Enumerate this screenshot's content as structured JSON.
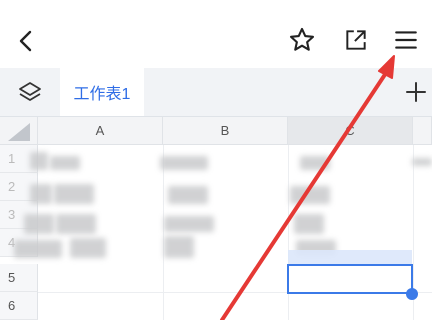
{
  "tabs": {
    "active_label": "工作表1"
  },
  "columns": [
    "A",
    "B",
    "C"
  ],
  "rows": [
    "1",
    "2",
    "3",
    "4",
    "5",
    "6"
  ],
  "colors": {
    "accent": "#2f6de6",
    "arrow": "#e53935"
  },
  "icons": [
    "back-icon",
    "star-icon",
    "share-icon",
    "menu-icon",
    "layers-icon",
    "plus-icon"
  ]
}
